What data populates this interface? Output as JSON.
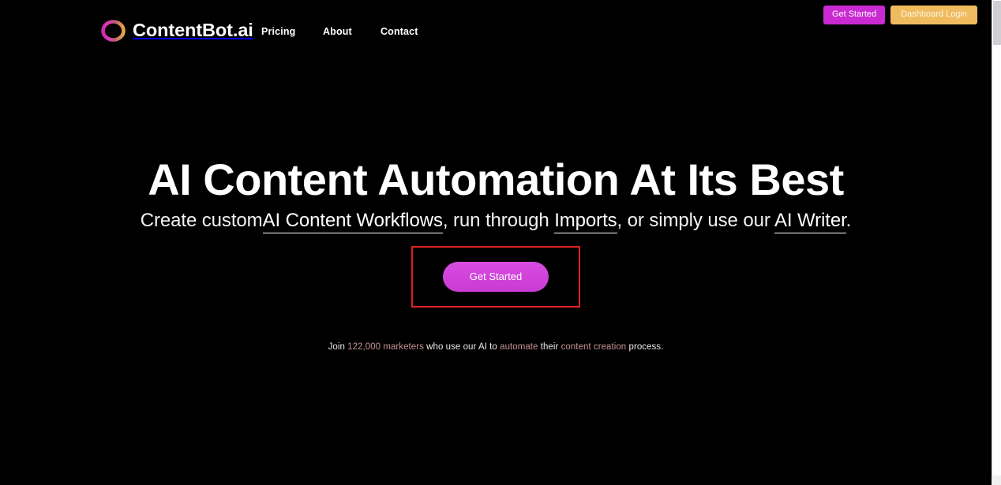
{
  "brand": {
    "name": "ContentBot.ai",
    "mark_icon": "ring-logo-icon",
    "mark_gradient_start": "#e23ab8",
    "mark_gradient_end": "#e8a84a"
  },
  "nav": {
    "links": [
      {
        "label": "Pricing"
      },
      {
        "label": "About"
      },
      {
        "label": "Contact"
      }
    ],
    "actions": {
      "get_started": {
        "label": "Get Started",
        "color": "#c92ad1"
      },
      "dashboard_login": {
        "label": "Dashboard Login",
        "color": "#f0bb5e"
      }
    }
  },
  "hero": {
    "title": "AI Content Automation At Its Best",
    "subtitle": {
      "lead": "Create custom",
      "link_1": "AI Content Workflows",
      "mid_1": ", run through ",
      "link_2": "Imports",
      "mid_2": ", or simply use our ",
      "link_3": "AI Writer",
      "tail": "."
    },
    "cta": {
      "label": "Get Started",
      "color": "#d84ce2",
      "highlight_color": "#e02020"
    },
    "note": {
      "part_1": "Join ",
      "accent_1": "122,000 marketers",
      "part_2": " who use our AI to ",
      "accent_2": "automate",
      "part_3": " their ",
      "accent_3": "content creation",
      "part_4": " process."
    }
  },
  "scrollbar": {
    "orientation": "vertical",
    "position": "top"
  }
}
